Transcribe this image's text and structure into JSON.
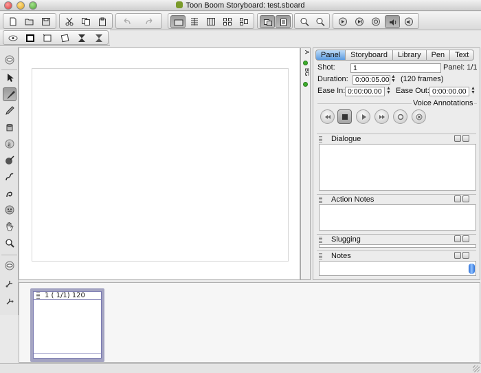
{
  "window": {
    "title": "Toon Boom Storyboard: test.sboard"
  },
  "toolbar": {
    "groups": [
      [
        "new-file-icon",
        "open-file-icon",
        "save-icon"
      ],
      [
        "cut-icon",
        "copy-icon",
        "paste-icon"
      ],
      [
        "undo-icon",
        "redo-icon"
      ],
      [
        "view-mode-1-icon",
        "view-mode-2-icon",
        "view-mode-3-icon",
        "view-mode-4-icon",
        "view-mode-5-icon"
      ],
      [
        "onion-skin-icon",
        "light-table-icon"
      ],
      [
        "zoom-in-icon",
        "zoom-out-icon"
      ],
      [
        "play-icon",
        "play-panel-icon",
        "loop-icon",
        "sound-icon",
        "sound-scrub-icon"
      ]
    ],
    "second_row": [
      "view-icon",
      "panel-1-icon",
      "panel-2-icon",
      "panel-3-icon",
      "flip-h-icon",
      "flip-v-icon"
    ]
  },
  "tools": [
    "view-tool-icon",
    "select-tool-icon",
    "brush-tool-icon",
    "pencil-tool-icon",
    "eraser-tool-icon",
    "text-tool-icon",
    "paint-tool-icon",
    "contour-tool-icon",
    "stroke-tool-icon",
    "transform-tool-icon",
    "hand-tool-icon",
    "zoom-tool-icon",
    "camera-view-icon",
    "camera-1-icon",
    "camera-2-icon"
  ],
  "layers": {
    "top_label": "A",
    "second_label": "BG"
  },
  "panel": {
    "tabs": [
      "Panel",
      "Storyboard",
      "Library",
      "Pen",
      "Text"
    ],
    "selected_tab": "Panel",
    "shot_label": "Shot:",
    "shot_value": "1",
    "panel_label": "Panel: 1/1",
    "duration_label": "Duration:",
    "duration_value": "0:00:05.00",
    "duration_frames": "(120 frames)",
    "ease_in_label": "Ease In:",
    "ease_in_value": "0:00:00.00",
    "ease_out_label": "Ease Out:",
    "ease_out_value": "0:00:00.00",
    "voice_annotations_label": "Voice Annotations",
    "sections": {
      "dialogue": "Dialogue",
      "action_notes": "Action Notes",
      "slugging": "Slugging",
      "notes": "Notes"
    }
  },
  "timeline": {
    "thumb_label": "1 ( 1/1)  120"
  },
  "colors": {
    "accent": "#5b9be0",
    "layer_dot": "#3cae2c"
  }
}
